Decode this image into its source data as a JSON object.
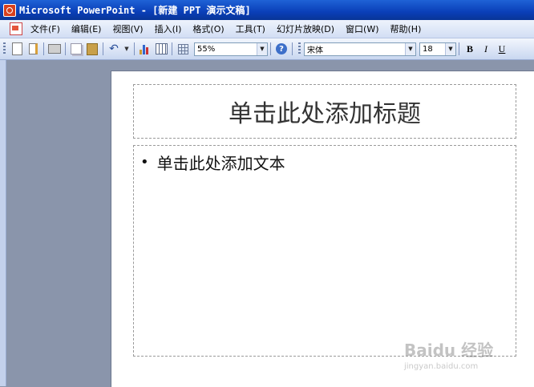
{
  "window": {
    "title": "Microsoft PowerPoint - [新建 PPT 演示文稿]"
  },
  "menu": {
    "items": [
      "文件(F)",
      "编辑(E)",
      "视图(V)",
      "插入(I)",
      "格式(O)",
      "工具(T)",
      "幻灯片放映(D)",
      "窗口(W)",
      "帮助(H)"
    ]
  },
  "toolbar": {
    "zoom": "55%",
    "font_name": "宋体",
    "font_size": "18",
    "bold": "B",
    "italic": "I",
    "underline": "U",
    "help_glyph": "?",
    "undo_glyph": "↶",
    "dropdown_glyph": "▼"
  },
  "slide": {
    "title_placeholder": "单击此处添加标题",
    "body_placeholder": "单击此处添加文本",
    "bullet_glyph": "•"
  },
  "watermark": {
    "text": "Baidu 经验",
    "sub": "jingyan.baidu.com"
  },
  "colors": {
    "titlebar": "#0a3fb8",
    "workspace": "#8a95ab",
    "slide": "#ffffff"
  }
}
